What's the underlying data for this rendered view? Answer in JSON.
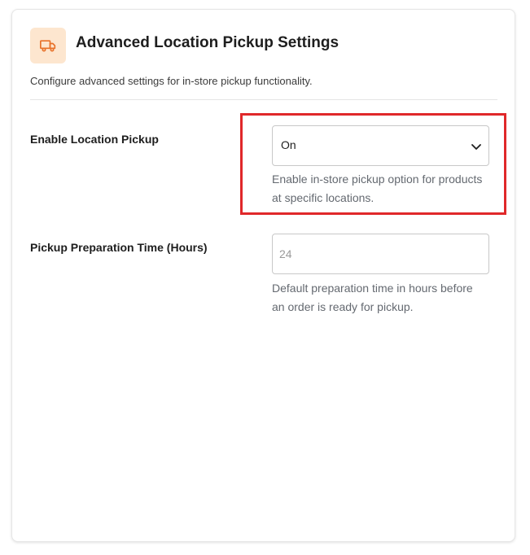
{
  "colors": {
    "accent": "#e8722a",
    "icon_bg": "#fde6cf",
    "highlight": "#e0282a"
  },
  "header": {
    "icon": "truck-icon",
    "title": "Advanced Location Pickup Settings",
    "description": "Configure advanced settings for in-store pickup functionality."
  },
  "fields": {
    "enable_pickup": {
      "label": "Enable Location Pickup",
      "value": "On",
      "help": "Enable in-store pickup option for products at specific locations."
    },
    "prep_time": {
      "label": "Pickup Preparation Time (Hours)",
      "placeholder": "24",
      "value": "",
      "help": "Default preparation time in hours before an order is ready for pickup."
    }
  }
}
